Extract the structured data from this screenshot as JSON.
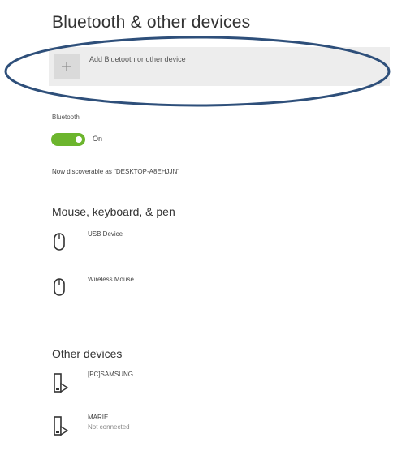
{
  "page": {
    "title": "Bluetooth & other devices"
  },
  "add_device": {
    "plus_icon": "plus-icon",
    "label": "Add Bluetooth or other device"
  },
  "bluetooth": {
    "section_label": "Bluetooth",
    "toggle_state": "On",
    "toggle_on": true,
    "toggle_color": "#6cb52d",
    "discoverable_text": "Now discoverable as \"DESKTOP-A8EHJJN\""
  },
  "mouse_keyboard_pen": {
    "heading": "Mouse, keyboard, & pen",
    "devices": [
      {
        "name": "USB Device",
        "icon": "mouse-icon"
      },
      {
        "name": "Wireless Mouse",
        "icon": "mouse-icon"
      }
    ]
  },
  "other_devices": {
    "heading": "Other devices",
    "devices": [
      {
        "name": "[PC]SAMSUNG",
        "status": "",
        "icon": "media-device-icon"
      },
      {
        "name": "MARIE",
        "status": "Not connected",
        "icon": "media-device-icon"
      }
    ]
  },
  "annotation": {
    "ellipse_color": "#2e4f7a"
  }
}
